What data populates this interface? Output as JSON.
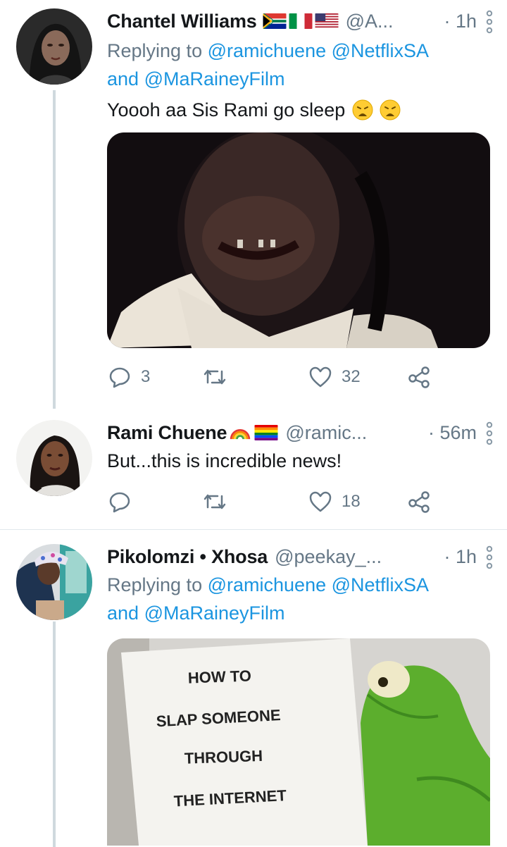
{
  "tweets": [
    {
      "display_name": "Chantel Williams",
      "flags": [
        "south-africa-flag",
        "italy-flag",
        "usa-flag"
      ],
      "handle": "@A...",
      "time": "· 1h",
      "replying_prefix": "Replying to",
      "replying_mentions": [
        "@ramichuene",
        "@NetflixSA"
      ],
      "replying_and": "and",
      "replying_last": "@MaRaineyFilm",
      "text": "Yoooh aa Sis Rami go sleep",
      "emojis": [
        "weary-face-emoji",
        "weary-face-emoji"
      ],
      "media": "video-still-man-smiling",
      "reply_count": "3",
      "retweet_count": "",
      "like_count": "32"
    },
    {
      "display_name": "Rami Chuene",
      "flags": [
        "rainbow-emoji",
        "rainbow-flag"
      ],
      "handle": "@ramic...",
      "time": "· 56m",
      "text": "But...this is incredible news!",
      "reply_count": "",
      "retweet_count": "",
      "like_count": "18"
    },
    {
      "display_name": "Pikolomzi • Xhosa",
      "handle": "@peekay_...",
      "time": "· 1h",
      "replying_prefix": "Replying to",
      "replying_mentions": [
        "@ramichuene",
        "@NetflixSA"
      ],
      "replying_and": "and",
      "replying_last": "@MaRaineyFilm",
      "media_text": [
        "HOW TO",
        "SLAP SOMEONE",
        "THROUGH",
        "THE INTERNET"
      ],
      "media": "kermit-meme"
    }
  ],
  "colors": {
    "link": "#1b95e0",
    "secondary": "#657786",
    "primary_text": "#14171a",
    "thread_line": "#cfd9de",
    "separator": "#e1e8ed"
  }
}
